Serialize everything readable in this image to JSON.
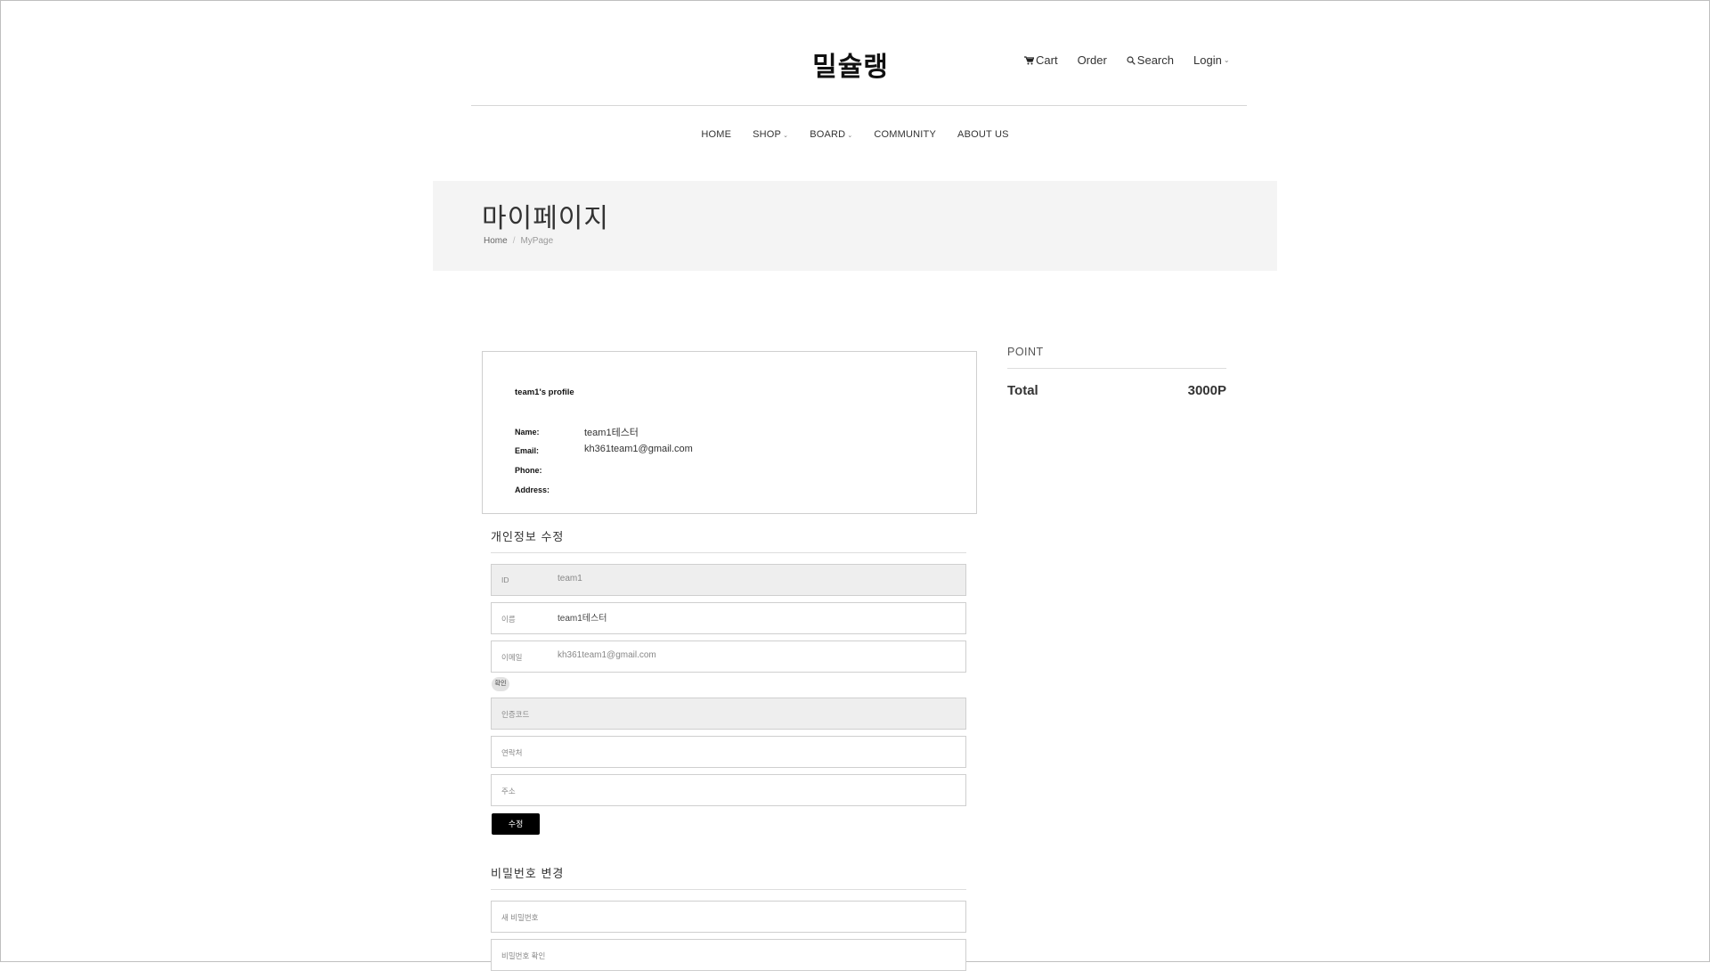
{
  "header": {
    "logo": "밀슐랭",
    "links": {
      "cart": "Cart",
      "order": "Order",
      "search": "Search",
      "login": "Login"
    }
  },
  "nav": {
    "home": "HOME",
    "shop": "SHOP",
    "board": "BOARD",
    "community": "COMMUNITY",
    "about": "ABOUT US"
  },
  "banner": {
    "title": "마이페이지",
    "breadcrumb_home": "Home",
    "breadcrumb_sep": "/",
    "breadcrumb_current": "MyPage"
  },
  "profile": {
    "title": "team1's profile",
    "name_label": "Name:",
    "name_value": "team1테스터",
    "email_label": "Email:",
    "email_value": "kh361team1@gmail.com",
    "phone_label": "Phone:",
    "phone_value": "",
    "address_label": "Address:",
    "address_value": ""
  },
  "point": {
    "title": "POINT",
    "total_label": "Total",
    "total_value": "3000P"
  },
  "edit_form": {
    "title": "개인정보 수정",
    "id_label": "ID",
    "id_value": "team1",
    "name_label": "이름",
    "name_value": "team1테스터",
    "email_label": "이메일",
    "email_value": "kh361team1@gmail.com",
    "confirm_button": "확인",
    "code_label": "인증코드",
    "phone_label": "연락처",
    "address_label": "주소",
    "submit_button": "수정"
  },
  "password_form": {
    "title": "비밀번호 변경",
    "new_password_label": "새 비밀번호",
    "confirm_password_label": "비밀번호 확인"
  }
}
